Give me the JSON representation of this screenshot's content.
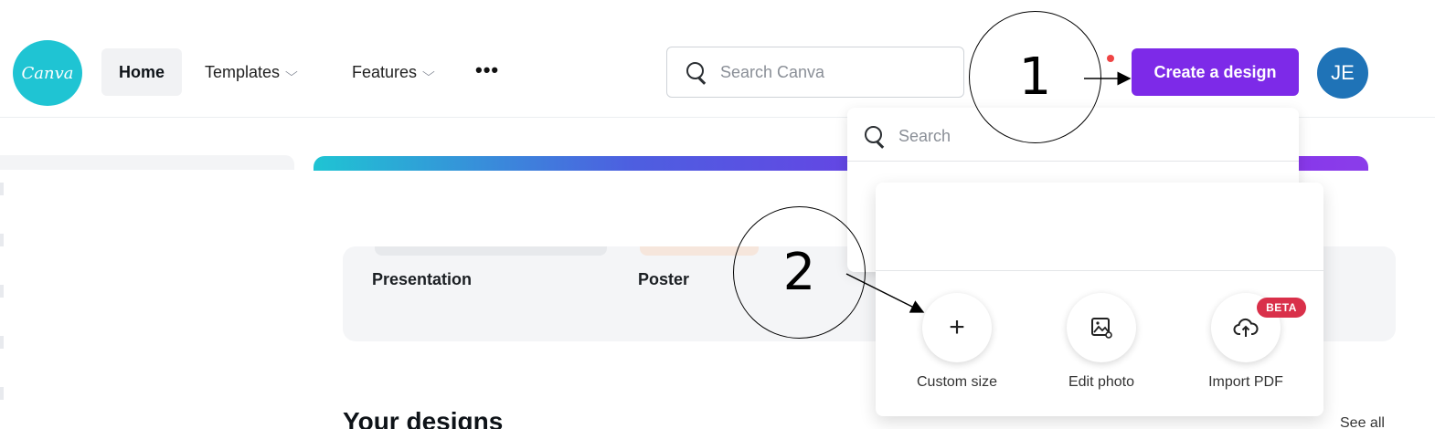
{
  "header": {
    "logo_text": "Canva",
    "nav": {
      "home": "Home",
      "templates": "Templates",
      "features": "Features",
      "more": "•••",
      "chevron": "⌵"
    },
    "search_placeholder": "Search Canva",
    "create_button": "Create a design",
    "avatar_initials": "JE"
  },
  "dropdown": {
    "search_placeholder": "Search",
    "actions": [
      {
        "label": "Custom size",
        "icon": "plus-icon",
        "glyph": "+"
      },
      {
        "label": "Edit photo",
        "icon": "edit-photo-icon",
        "glyph": "🖼"
      },
      {
        "label": "Import PDF",
        "icon": "cloud-upload-icon",
        "glyph": "☁",
        "badge": "BETA"
      }
    ]
  },
  "design_types": [
    "Presentation",
    "Poster"
  ],
  "sections": {
    "your_designs": "Your designs",
    "see_all": "See all"
  },
  "annotations": {
    "step1": "1",
    "step2": "2"
  },
  "colors": {
    "brand_purple": "#7d2ae8",
    "logo_teal": "#1fc4d3",
    "avatar_blue": "#1f73b7",
    "beta_red": "#d9304a"
  }
}
